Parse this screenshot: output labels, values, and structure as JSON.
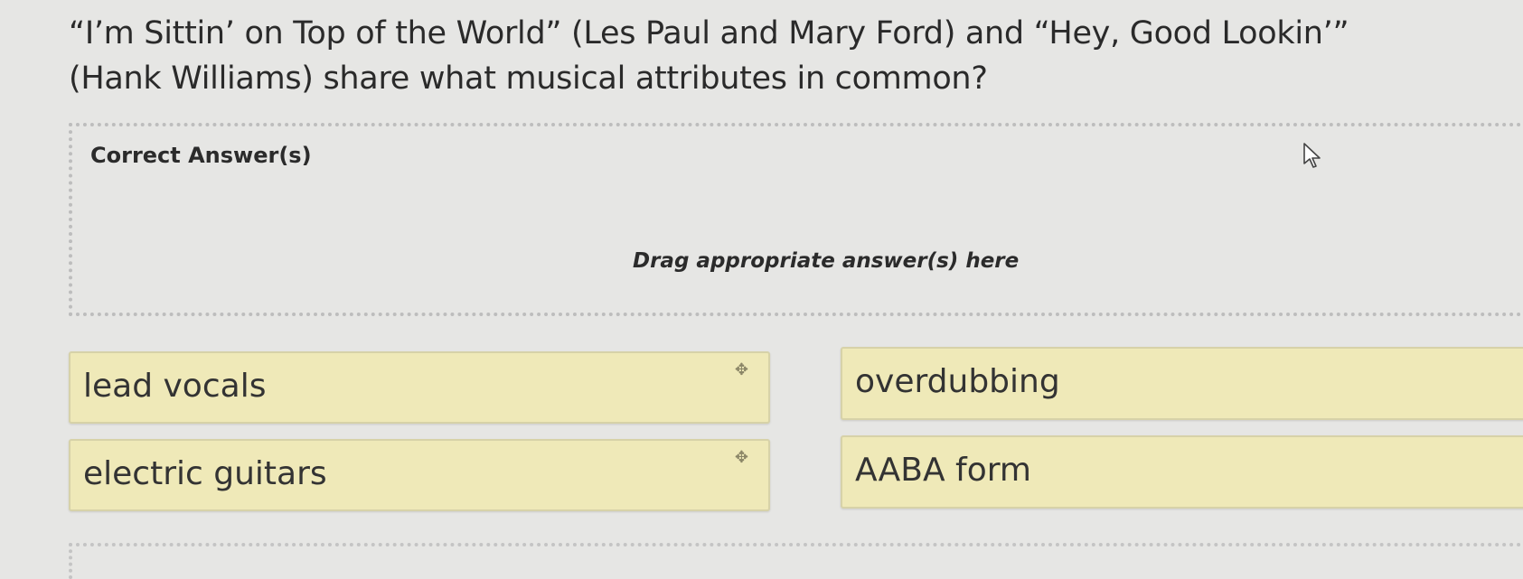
{
  "question": {
    "text": "“I’m Sittin’ on Top of the World” (Les Paul and Mary Ford) and “Hey, Good Lookin’” (Hank Williams) share what musical attributes in common?"
  },
  "dropzone": {
    "label": "Correct Answer(s)",
    "hint": "Drag appropriate answer(s) here"
  },
  "answers": [
    {
      "label": "lead vocals"
    },
    {
      "label": "electric guitars"
    },
    {
      "label": "overdubbing"
    },
    {
      "label": "AABA form"
    }
  ],
  "icons": {
    "drag_handle": "move-icon",
    "cursor": "mouse-pointer-icon"
  },
  "colors": {
    "background": "#e6e6e4",
    "answer_fill": "#efe9b8",
    "answer_border": "#d7d2a8"
  }
}
